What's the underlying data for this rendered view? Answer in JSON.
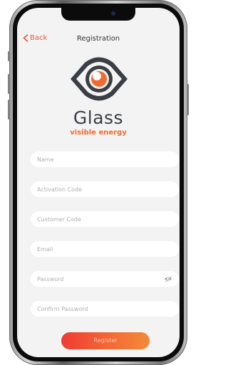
{
  "header": {
    "back_label": "Back",
    "title": "Registration"
  },
  "brand": {
    "name": "Glass",
    "tagline": "visible energy"
  },
  "form": {
    "name_placeholder": "Name",
    "activation_code_placeholder": "Activation Code",
    "customer_code_placeholder": "Customer Code",
    "email_placeholder": "Email",
    "password_placeholder": "Password",
    "confirm_password_placeholder": "Confirm Password",
    "register_label": "Register"
  },
  "icons": {
    "back": "chevron-left-icon",
    "logo": "eye-logo-icon",
    "password_toggle": "eye-slash-icon"
  },
  "colors": {
    "accent": "#e8573c",
    "brand_orange": "#f36a30",
    "logo_gray": "#3b3f44",
    "button_gradient_start": "#ef3b33",
    "button_gradient_end": "#f48a3a"
  }
}
